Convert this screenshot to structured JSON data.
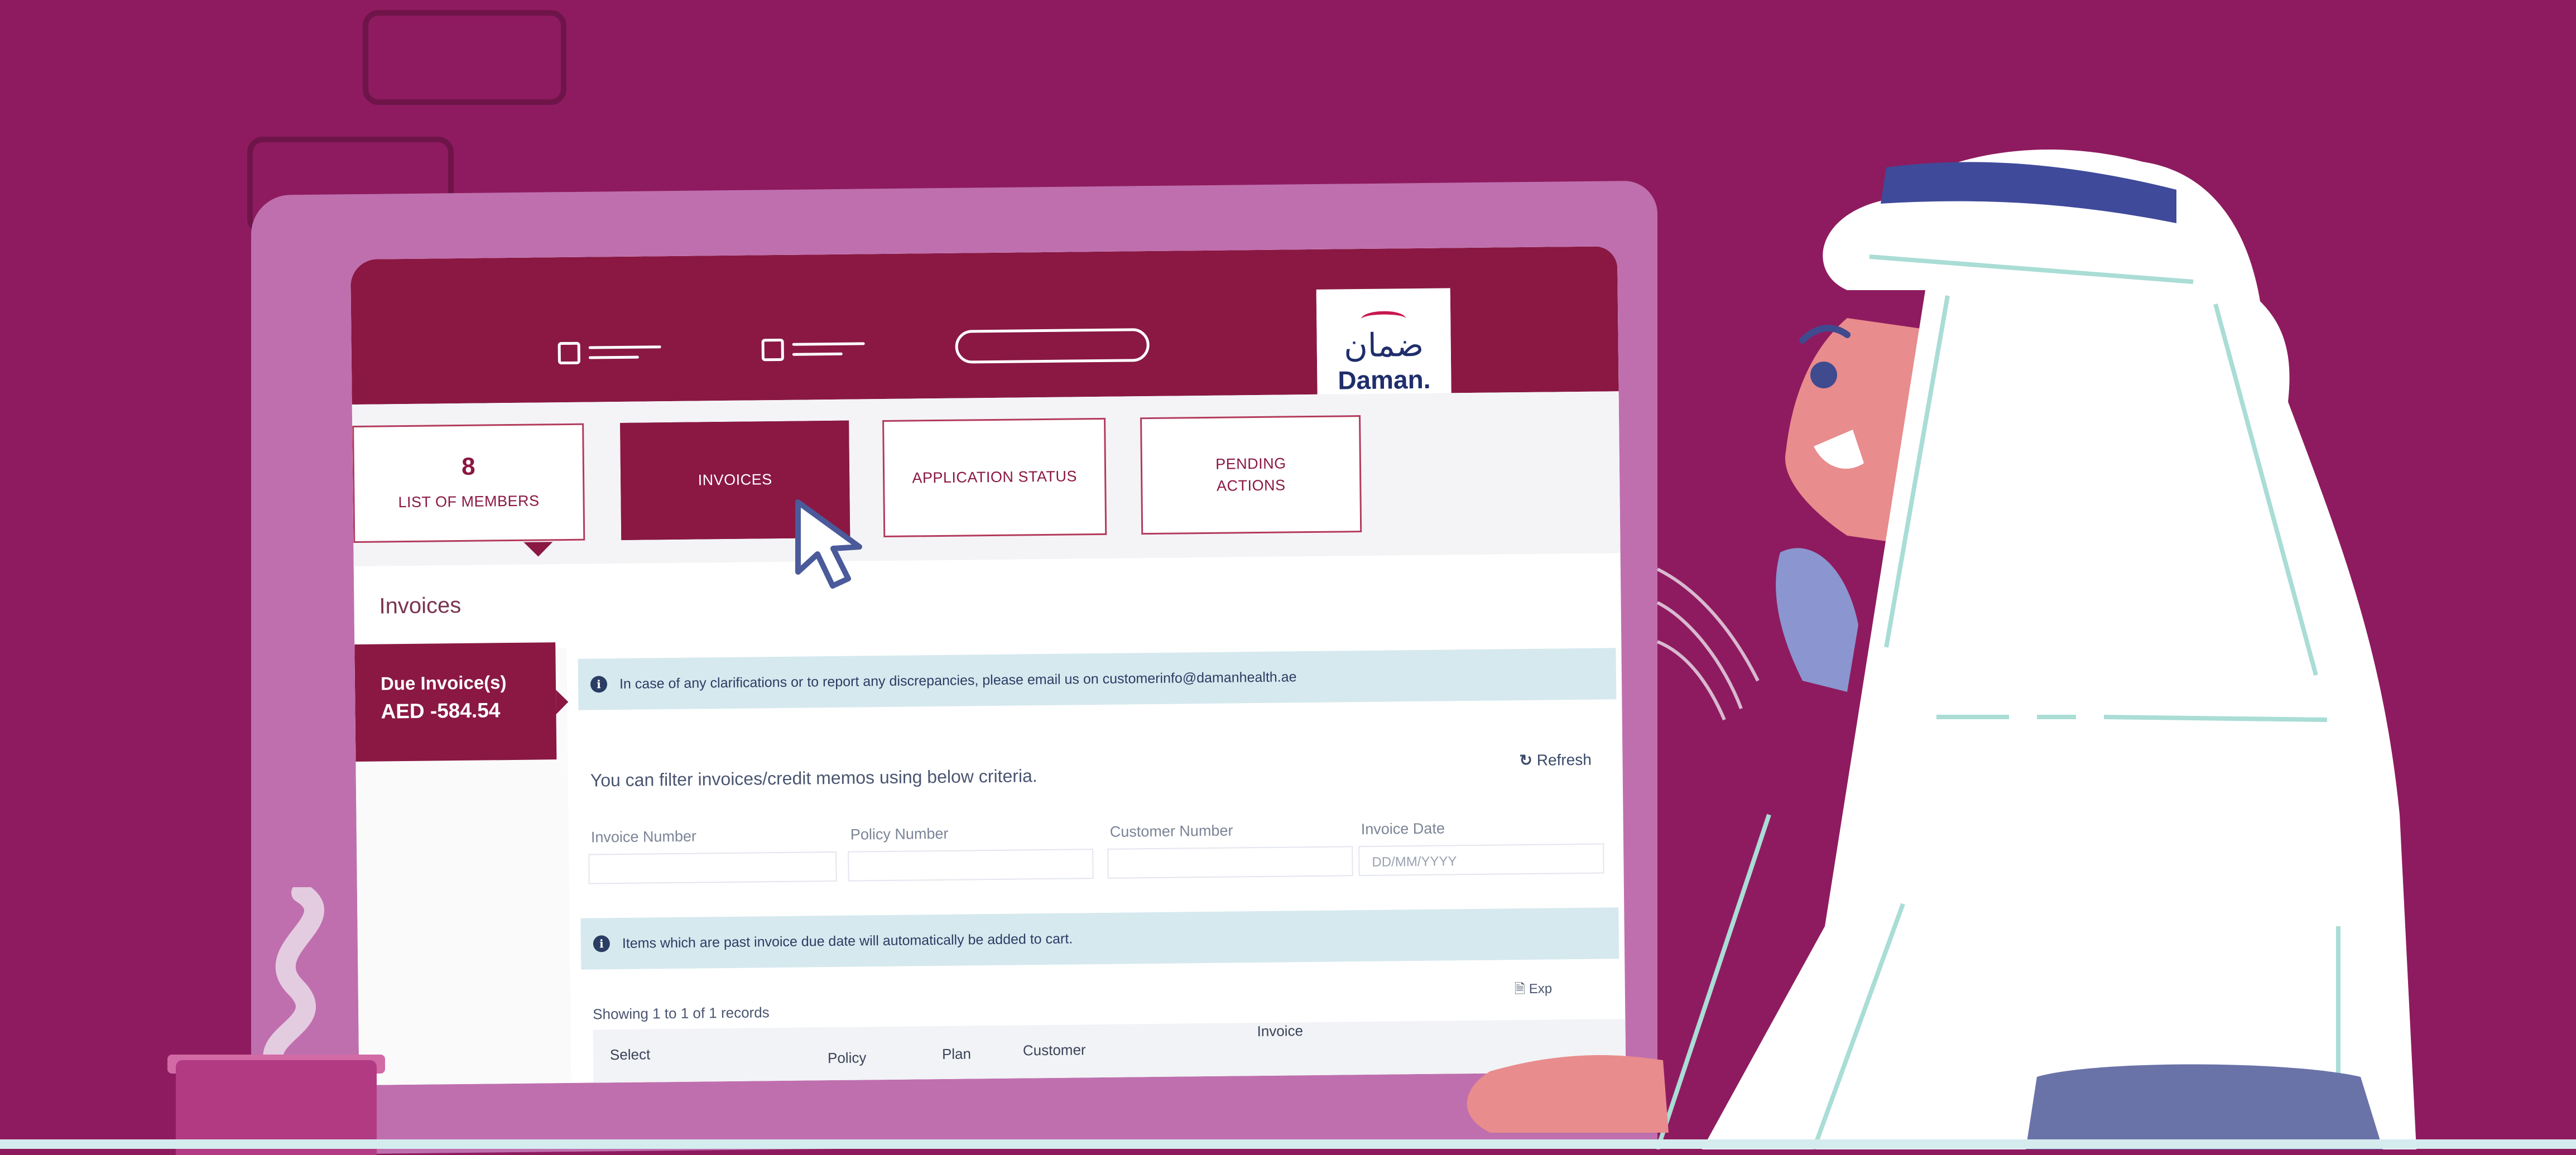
{
  "header": {
    "logo_arabic": "ضمان",
    "logo_text": "Daman."
  },
  "tiles": [
    {
      "count": "8",
      "label": "LIST OF MEMBERS"
    },
    {
      "label": "INVOICES"
    },
    {
      "label": "APPLICATION STATUS"
    },
    {
      "label_line1": "PENDING",
      "label_line2": "ACTIONS"
    }
  ],
  "section": {
    "title": "Invoices"
  },
  "due_invoice": {
    "label": "Due Invoice(s)",
    "amount": "AED -584.54"
  },
  "notices": {
    "contact": "In case of any clarifications or to report any discrepancies, please email us on customerinfo@damanhealth.ae",
    "past_due": "Items which are past invoice due date will automatically be added to cart."
  },
  "filter": {
    "intro": "You can filter invoices/credit memos using below criteria.",
    "refresh_label": "Refresh",
    "fields": [
      {
        "label": "Invoice Number",
        "placeholder": ""
      },
      {
        "label": "Policy Number",
        "placeholder": ""
      },
      {
        "label": "Customer Number",
        "placeholder": ""
      },
      {
        "label": "Invoice Date",
        "placeholder": "DD/MM/YYYY"
      }
    ]
  },
  "table": {
    "showing": "Showing 1 to 1 of 1 records",
    "export_label": "Exp",
    "columns": [
      "Select",
      "Policy",
      "Plan",
      "Customer",
      "Invoice"
    ]
  },
  "icons": {
    "info": "info-icon",
    "refresh": "refresh-icon",
    "export": "document-icon",
    "cursor": "mouse-pointer-icon"
  },
  "colors": {
    "background": "#8e1b5f",
    "brand": "#8a1843",
    "info_bar": "#d6e9ef",
    "monitor": "#bf6fae"
  }
}
